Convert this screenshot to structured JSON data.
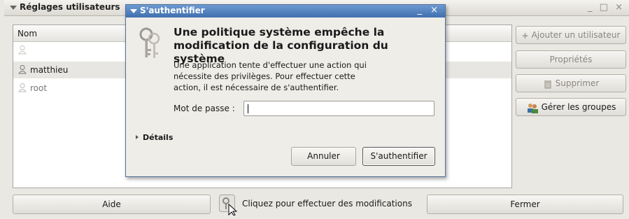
{
  "main_window": {
    "title": "Réglages utilisateurs",
    "controls": "_ □ ×",
    "list": {
      "column_header": "Nom",
      "users": [
        {
          "name": ""
        },
        {
          "name": "matthieu"
        },
        {
          "name": "root"
        }
      ]
    },
    "side_buttons": {
      "add_user": "Ajouter un utilisateur",
      "properties": "Propriétés",
      "delete": "Supprimer",
      "manage_groups": "Gérer les groupes"
    },
    "bottom": {
      "help": "Aide",
      "unlock_hint": "Cliquez pour effectuer des modifications",
      "close": "Fermer"
    }
  },
  "auth_dialog": {
    "title": "S'authentifier",
    "controls": "_ ×",
    "heading": "Une politique système empêche la modification de la configuration du système",
    "description": "Une application tente d'effectuer une action qui nécessite des privilèges. Pour effectuer cette action, il est nécessaire de s'authentifier.",
    "password_label": "Mot de passe :",
    "password_value": "",
    "details_label": "Détails",
    "cancel_label": "Annuler",
    "authenticate_label": "S'authentifier"
  },
  "colors": {
    "dialog_title_bar": "#4f7fbe",
    "window_bg": "#eae8e3"
  }
}
